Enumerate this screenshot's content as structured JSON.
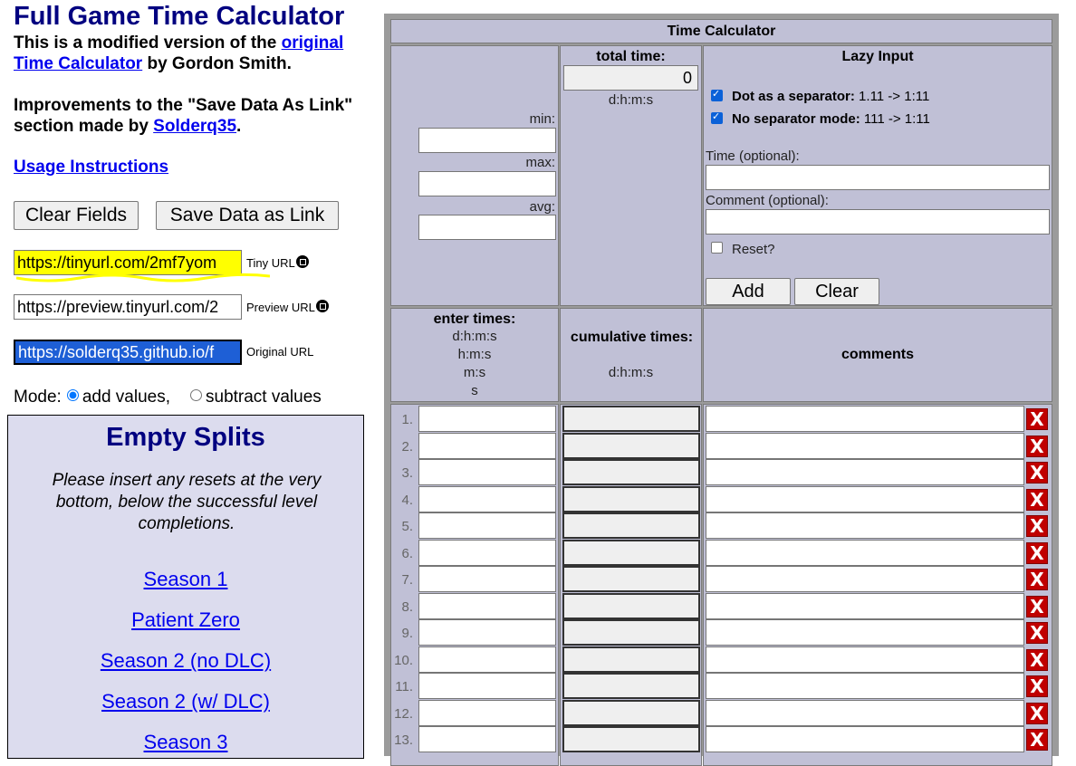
{
  "page": {
    "title": "Full Game Time Calculator",
    "intro_prefix": "This is a modified version of the ",
    "intro_link": "original Time Calculator",
    "intro_suffix": " by Gordon Smith.",
    "improve_prefix": "Improvements to the \"Save Data As Link\" section made by ",
    "improve_link": "Solderq35",
    "improve_suffix": ".",
    "usage_link": "Usage Instructions"
  },
  "buttons": {
    "clear_fields": "Clear Fields",
    "save_link": "Save Data as Link"
  },
  "urls": [
    {
      "value": "https://tinyurl.com/2mf7yom",
      "label_a": "Tiny",
      "label_b": " URL"
    },
    {
      "value": "https://preview.tinyurl.com/2",
      "label_a": "Preview URL",
      "label_b": ""
    },
    {
      "value": "https://solderq35.github.io/f",
      "label_a": "Original URL",
      "label_b": ""
    }
  ],
  "mode": {
    "label": "Mode:",
    "add": "add values,",
    "subtract": "subtract values",
    "selected": "add"
  },
  "splits": {
    "title": "Empty Splits",
    "note": "Please insert any resets at the very bottom, below the successful level completions.",
    "links": [
      "Season 1",
      "Patient Zero",
      "Season 2 (no DLC)",
      "Season 2 (w/ DLC)",
      "Season 3"
    ]
  },
  "calc": {
    "title": "Time Calculator",
    "stats": {
      "min": "min:",
      "max": "max:",
      "avg": "avg:"
    },
    "total": {
      "label": "total time:",
      "value": "0",
      "format": "d:h:m:s"
    },
    "lazy": {
      "title": "Lazy Input",
      "dot_label": "Dot as a separator:",
      "dot_example": " 1.11 -> 1:11",
      "dot_checked": true,
      "nosep_label": "No separator mode:",
      "nosep_example": " 111 -> 1:11",
      "nosep_checked": true,
      "time_label": "Time (optional):",
      "comment_label": "Comment (optional):",
      "reset_label": "Reset?",
      "reset_checked": false,
      "add": "Add",
      "clear": "Clear"
    },
    "headers": {
      "enter": "enter times:",
      "enter_formats": [
        "d:h:m:s",
        "h:m:s",
        "m:s",
        "s"
      ],
      "cumulative": "cumulative times:",
      "cumulative_format": "d:h:m:s",
      "comments": "comments"
    },
    "rows": [
      "1.",
      "2.",
      "3.",
      "4.",
      "5.",
      "6.",
      "7.",
      "8.",
      "9.",
      "10.",
      "11.",
      "12.",
      "13."
    ],
    "delete_glyph": "X"
  }
}
